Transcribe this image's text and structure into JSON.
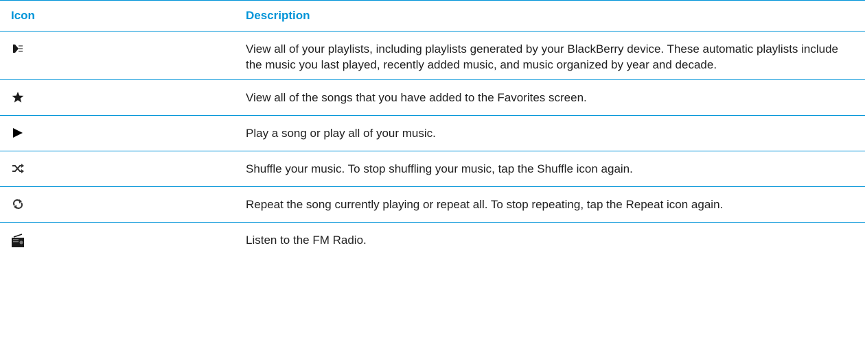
{
  "table": {
    "headers": {
      "icon": "Icon",
      "description": "Description"
    },
    "rows": [
      {
        "icon": "playlists-icon",
        "description": "View all of your playlists, including playlists generated by your BlackBerry device. These automatic playlists include the music you last played, recently added music, and music organized by year and decade."
      },
      {
        "icon": "star-icon",
        "description": "View all of the songs that you have added to the Favorites screen."
      },
      {
        "icon": "play-icon",
        "description": "Play a song or play all of your music."
      },
      {
        "icon": "shuffle-icon",
        "description": "Shuffle your music. To stop shuffling your music, tap the Shuffle icon again."
      },
      {
        "icon": "repeat-icon",
        "description": "Repeat the song currently playing or repeat all. To stop repeating, tap the Repeat icon again."
      },
      {
        "icon": "radio-icon",
        "description": "Listen to the FM Radio."
      }
    ]
  },
  "colors": {
    "accent": "#0094d8",
    "text": "#1f1f1f",
    "icon": "#1a1a1a"
  }
}
